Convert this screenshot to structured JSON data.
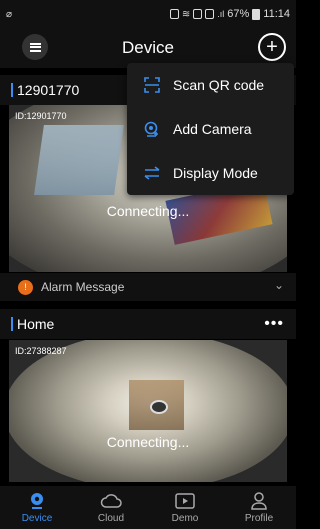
{
  "status_bar": {
    "battery": "67%",
    "time": "11:14"
  },
  "header": {
    "title": "Device"
  },
  "dropdown": {
    "items": [
      {
        "label": "Scan QR code",
        "icon": "scan-qr-icon"
      },
      {
        "label": "Add Camera",
        "icon": "add-camera-icon"
      },
      {
        "label": "Display Mode",
        "icon": "display-mode-icon"
      }
    ]
  },
  "devices": [
    {
      "name": "12901770",
      "id_text": "ID:12901770",
      "status": "Connecting...",
      "alarm_label": "Alarm Message"
    },
    {
      "name": "Home",
      "id_text": "ID:27388287",
      "status": "Connecting..."
    }
  ],
  "bottom_nav": {
    "items": [
      {
        "label": "Device",
        "icon": "camera-icon"
      },
      {
        "label": "Cloud",
        "icon": "cloud-icon"
      },
      {
        "label": "Demo",
        "icon": "play-icon"
      },
      {
        "label": "Profile",
        "icon": "person-icon"
      }
    ]
  },
  "colors": {
    "accent": "#3a8ef0",
    "alarm": "#e86e1a",
    "background": "#000000"
  }
}
